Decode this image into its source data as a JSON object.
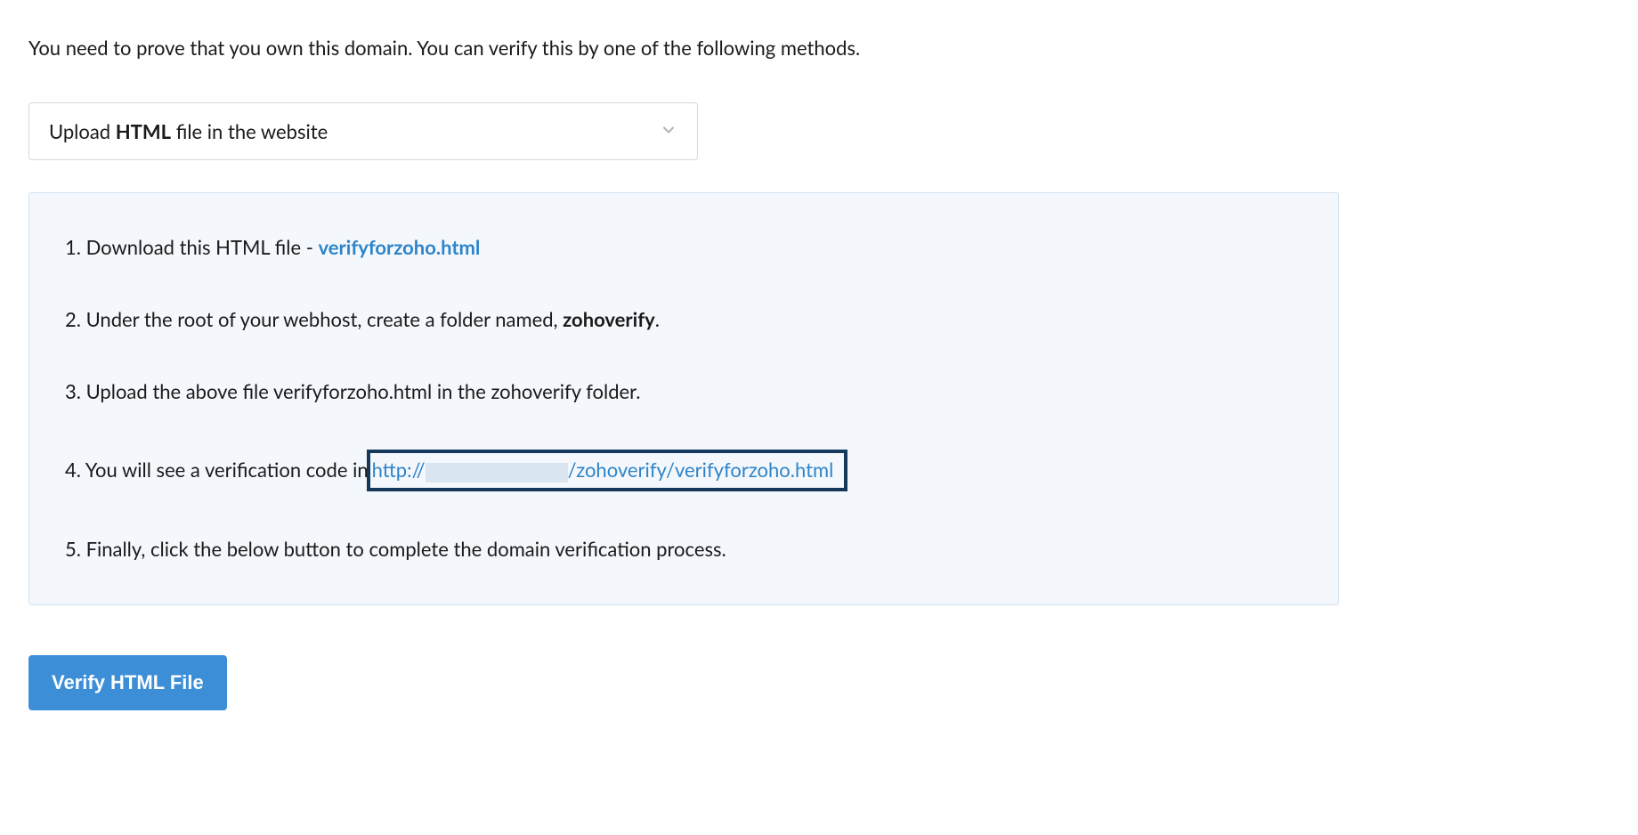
{
  "intro": "You need to prove that you own this domain. You can verify this by one of the following methods.",
  "dropdown": {
    "label_pre": "Upload ",
    "label_bold": "HTML",
    "label_post": " file in the website"
  },
  "steps": {
    "s1_pre": "1. Download this HTML file - ",
    "s1_link": "verifyforzoho.html",
    "s2_pre": "2. Under the root of your webhost, create a folder named, ",
    "s2_bold": "zohoverify",
    "s2_post": ".",
    "s3": "3. Upload the above file verifyforzoho.html in the zohoverify folder.",
    "s4_pre": "4. You will see a verification code in",
    "s4_url_pre": " http://",
    "s4_url_post": "/zohoverify/verifyforzoho.html",
    "s5": "5. Finally, click the below button to complete the domain verification process."
  },
  "button": {
    "verify": "Verify HTML File"
  }
}
